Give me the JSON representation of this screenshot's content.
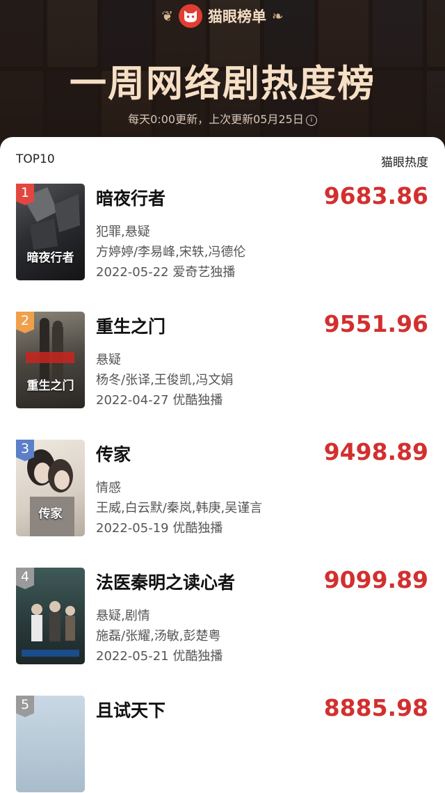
{
  "header": {
    "brand": "猫眼榜单",
    "title": "一周网络剧热度榜",
    "update_note": "每天0:00更新，上次更新05月25日"
  },
  "list": {
    "top_label": "TOP10",
    "metric_label": "猫眼热度",
    "items": [
      {
        "rank": "1",
        "title": "暗夜行者",
        "genre": "犯罪,悬疑",
        "cast": "方婷婷/李易峰,宋轶,冯德伦",
        "release": "2022-05-22 爱奇艺独播",
        "score": "9683.86",
        "poster_text": "暗夜行者"
      },
      {
        "rank": "2",
        "title": "重生之门",
        "genre": "悬疑",
        "cast": "杨冬/张译,王俊凯,冯文娟",
        "release": "2022-04-27 优酷独播",
        "score": "9551.96",
        "poster_text": "重生之门"
      },
      {
        "rank": "3",
        "title": "传家",
        "genre": "情感",
        "cast": "王威,白云默/秦岚,韩庚,吴谨言",
        "release": "2022-05-19 优酷独播",
        "score": "9498.89",
        "poster_text": "传家"
      },
      {
        "rank": "4",
        "title": "法医秦明之读心者",
        "genre": "悬疑,剧情",
        "cast": "施磊/张耀,汤敏,彭楚粤",
        "release": "2022-05-21 优酷独播",
        "score": "9099.89",
        "poster_text": ""
      },
      {
        "rank": "5",
        "title": "且试天下",
        "genre": "",
        "cast": "",
        "release": "",
        "score": "8885.98",
        "poster_text": ""
      }
    ]
  },
  "colors": {
    "accent_red": "#d32f2f",
    "badge_1": "#e2473f",
    "badge_2": "#f0a04b",
    "badge_3": "#5b7fc8",
    "badge_4": "#9a9a9a",
    "badge_5": "#9a9a9a"
  },
  "icons": {
    "logo": "cat-icon",
    "laurel": "laurel-icon",
    "info": "info-icon"
  }
}
